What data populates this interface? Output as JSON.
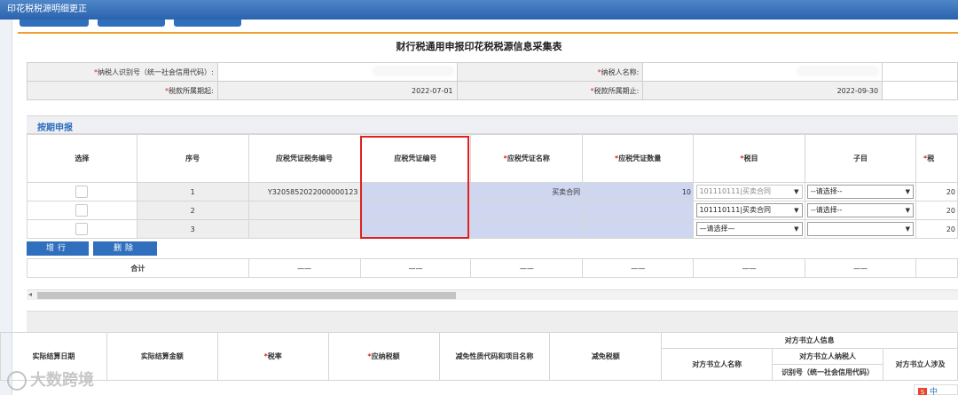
{
  "window": {
    "title": "印花税税源明细更正"
  },
  "page": {
    "title": "财行税通用申报印花税税源信息采集表"
  },
  "header_info": {
    "taxpayer_id_label": "纳税人识别号（统一社会信用代码）:",
    "taxpayer_name_label": "纳税人名称:",
    "period_start_label": "税款所属期起:",
    "period_start_value": "2022-07-01",
    "period_end_label": "税款所属期止:",
    "period_end_value": "2022-09-30"
  },
  "section": {
    "title": "按期申报"
  },
  "grid": {
    "headers": [
      "选择",
      "序号",
      "应税凭证税务编号",
      "应税凭证编号",
      "应税凭证名称",
      "应税凭证数量",
      "税目",
      "子目",
      "税"
    ],
    "required": [
      false,
      false,
      false,
      false,
      true,
      true,
      true,
      false,
      true
    ],
    "rows": [
      {
        "seq": "1",
        "tax_no": "Y3205852022000000123",
        "voucher_no": "",
        "voucher_name": "买卖合同",
        "qty": "10",
        "item": "101110111|买卖合同",
        "sub": "--请选择--",
        "rate_part": "20"
      },
      {
        "seq": "2",
        "tax_no": "",
        "voucher_no": "",
        "voucher_name": "",
        "qty": "",
        "item": "101110111|买卖合同",
        "sub": "--请选择--",
        "rate_part": "20"
      },
      {
        "seq": "3",
        "tax_no": "",
        "voucher_no": "",
        "voucher_name": "",
        "qty": "",
        "item": "—请选择—",
        "sub": "",
        "rate_part": "20"
      }
    ]
  },
  "buttons": {
    "add": "增行",
    "delete": "删除"
  },
  "summary": {
    "label": "合计",
    "dash": "——"
  },
  "bottom_headers": {
    "settle_date": "实际结算日期",
    "settle_amount": "实际结算金额",
    "rate": "税率",
    "tax_payable": "应纳税额",
    "reduction_code": "减免性质代码和项目名称",
    "reduction_amount": "减免税额",
    "counterparty_group": "对方书立人信息",
    "counterparty_name": "对方书立人名称",
    "counterparty_id_line1": "对方书立人纳税人",
    "counterparty_id_line2": "识别号（统一社会信用代码）",
    "counterparty_involved": "对方书立人涉及"
  },
  "watermark": {
    "text": "大数跨境"
  },
  "ime": {
    "label": "中"
  }
}
